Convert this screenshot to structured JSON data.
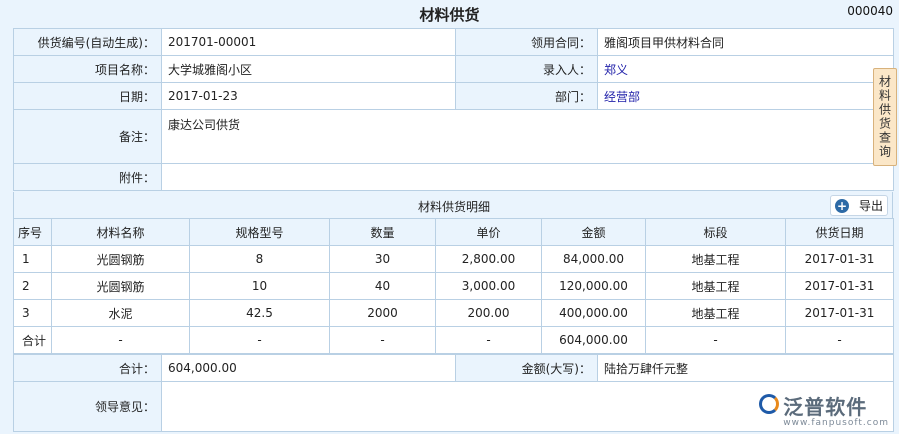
{
  "header": {
    "title": "材料供货",
    "doc_number": "000040"
  },
  "form": {
    "supply_no_label": "供货编号(自动生成)：",
    "supply_no_value": "201701-00001",
    "contract_label": "领用合同：",
    "contract_value": "雅阁项目甲供材料合同",
    "project_label": "项目名称：",
    "project_value": "大学城雅阁小区",
    "entry_person_label": "录入人：",
    "entry_person_value": "郑义",
    "date_label": "日期：",
    "date_value": "2017-01-23",
    "dept_label": "部门：",
    "dept_value": "经营部",
    "remark_label": "备注：",
    "remark_value": "康达公司供货",
    "attachment_label": "附件：",
    "attachment_value": ""
  },
  "side_tab": {
    "label": "材料供货查询"
  },
  "detail": {
    "title": "材料供货明细",
    "export_label": "导出",
    "columns": [
      "序号",
      "材料名称",
      "规格型号",
      "数量",
      "单价",
      "金额",
      "标段",
      "供货日期"
    ],
    "rows": [
      [
        "1",
        "光圆钢筋",
        "8",
        "30",
        "2,800.00",
        "84,000.00",
        "地基工程",
        "2017-01-31"
      ],
      [
        "2",
        "光圆钢筋",
        "10",
        "40",
        "3,000.00",
        "120,000.00",
        "地基工程",
        "2017-01-31"
      ],
      [
        "3",
        "水泥",
        "42.5",
        "2000",
        "200.00",
        "400,000.00",
        "地基工程",
        "2017-01-31"
      ]
    ],
    "total_row": [
      "合计",
      "-",
      "-",
      "-",
      "-",
      "604,000.00",
      "-",
      "-"
    ]
  },
  "footer": {
    "total_label": "合计：",
    "total_value": "604,000.00",
    "amount_cn_label": "金额(大写)：",
    "amount_cn_value": "陆拾万肆仟元整",
    "opinion_label": "领导意见：",
    "opinion_value": ""
  },
  "watermark": {
    "name": "泛普软件",
    "url": "www.fanpusoft.com"
  }
}
